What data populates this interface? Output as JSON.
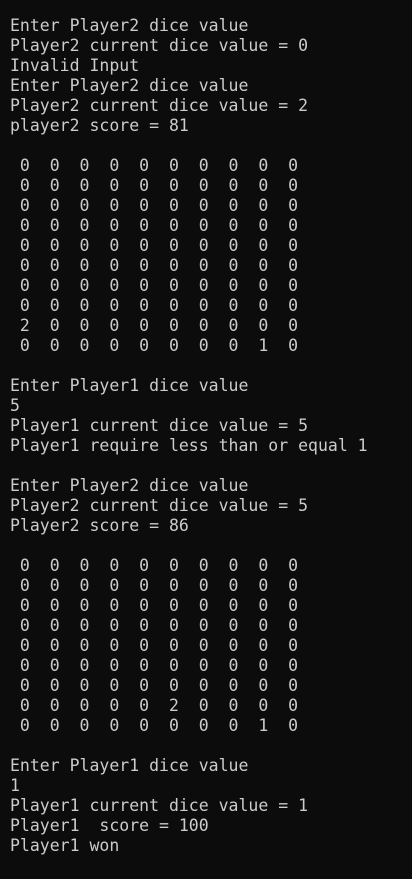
{
  "console": {
    "lines": [
      "Enter Player2 dice value",
      "Player2 current dice value = 0",
      "Invalid Input",
      "Enter Player2 dice value",
      "Player2 current dice value = 2",
      "player2 score = 81",
      "",
      " 0  0  0  0  0  0  0  0  0  0",
      " 0  0  0  0  0  0  0  0  0  0",
      " 0  0  0  0  0  0  0  0  0  0",
      " 0  0  0  0  0  0  0  0  0  0",
      " 0  0  0  0  0  0  0  0  0  0",
      " 0  0  0  0  0  0  0  0  0  0",
      " 0  0  0  0  0  0  0  0  0  0",
      " 0  0  0  0  0  0  0  0  0  0",
      " 2  0  0  0  0  0  0  0  0  0",
      " 0  0  0  0  0  0  0  0  1  0",
      "",
      "Enter Player1 dice value",
      "5",
      "Player1 current dice value = 5",
      "Player1 require less than or equal 1",
      "",
      "Enter Player2 dice value",
      "Player2 current dice value = 5",
      "Player2 score = 86",
      "",
      " 0  0  0  0  0  0  0  0  0  0",
      " 0  0  0  0  0  0  0  0  0  0",
      " 0  0  0  0  0  0  0  0  0  0",
      " 0  0  0  0  0  0  0  0  0  0",
      " 0  0  0  0  0  0  0  0  0  0",
      " 0  0  0  0  0  0  0  0  0  0",
      " 0  0  0  0  0  0  0  0  0  0",
      " 0  0  0  0  0  2  0  0  0  0",
      " 0  0  0  0  0  0  0  0  1  0",
      "",
      "Enter Player1 dice value",
      "1",
      "Player1 current dice value = 1",
      "Player1  score = 100",
      "Player1 won"
    ]
  },
  "colors": {
    "background": "#0c0c0c",
    "text": "#cccccc"
  }
}
